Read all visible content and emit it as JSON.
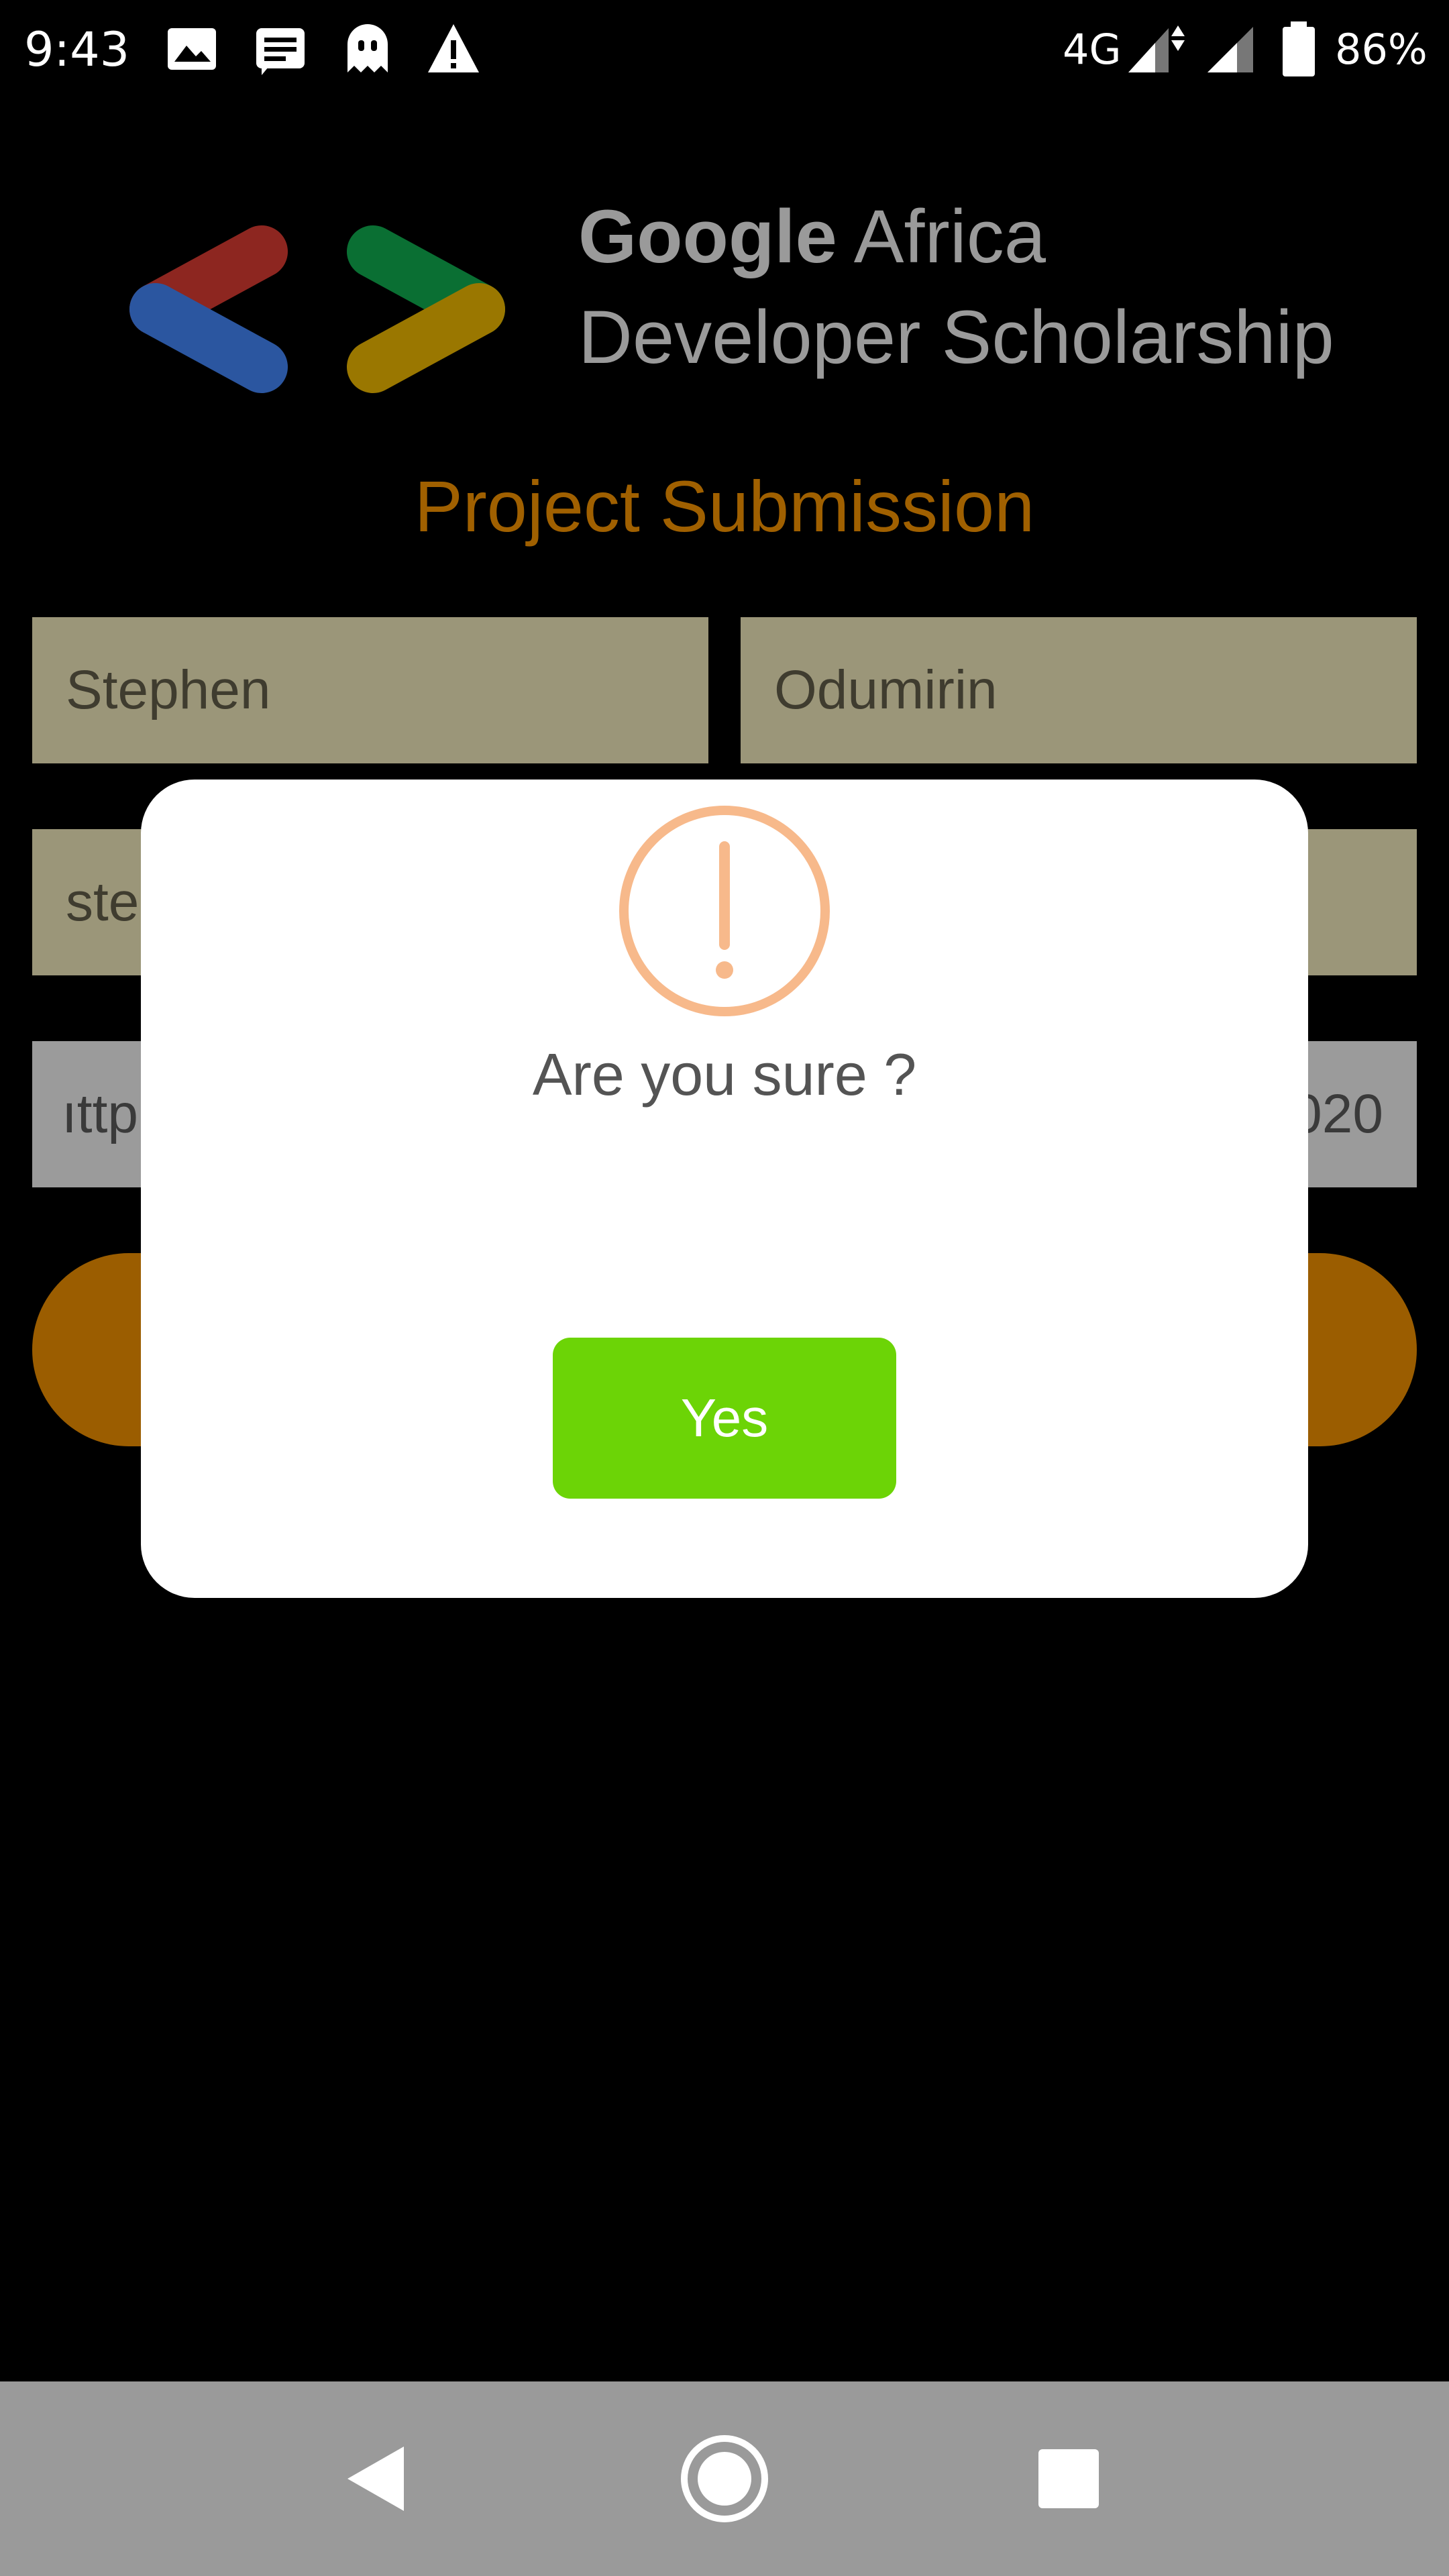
{
  "status_bar": {
    "time": "9:43",
    "network": "4G",
    "battery": "86%",
    "icons": [
      "image-icon",
      "message-icon",
      "ghost-icon",
      "warning-icon",
      "signal-icon",
      "signal-icon",
      "battery-icon"
    ]
  },
  "header": {
    "logo_line1_bold": "Google",
    "logo_line1_rest": " Africa",
    "logo_line2": "Developer Scholarship"
  },
  "form": {
    "title": "Project Submission",
    "first_name": "Stephen",
    "last_name": "Odumirin",
    "email_visible": "ste",
    "link_visible_start": "ıttp",
    "link_visible_end": "020"
  },
  "dialog": {
    "icon": "exclamation-circle-icon",
    "message": "Are you sure ?",
    "yes_label": "Yes"
  },
  "nav_bar": {
    "icons": [
      "back-icon",
      "home-icon",
      "recents-icon"
    ]
  },
  "colors": {
    "title": "#a06000",
    "field_bg": "#9b9679",
    "button_bg": "#9b5d00",
    "dialog_bg": "#ffffff",
    "yes_bg": "#6cd406",
    "alert_icon": "#f7b98b",
    "nav_bg": "#9a9a9a"
  }
}
